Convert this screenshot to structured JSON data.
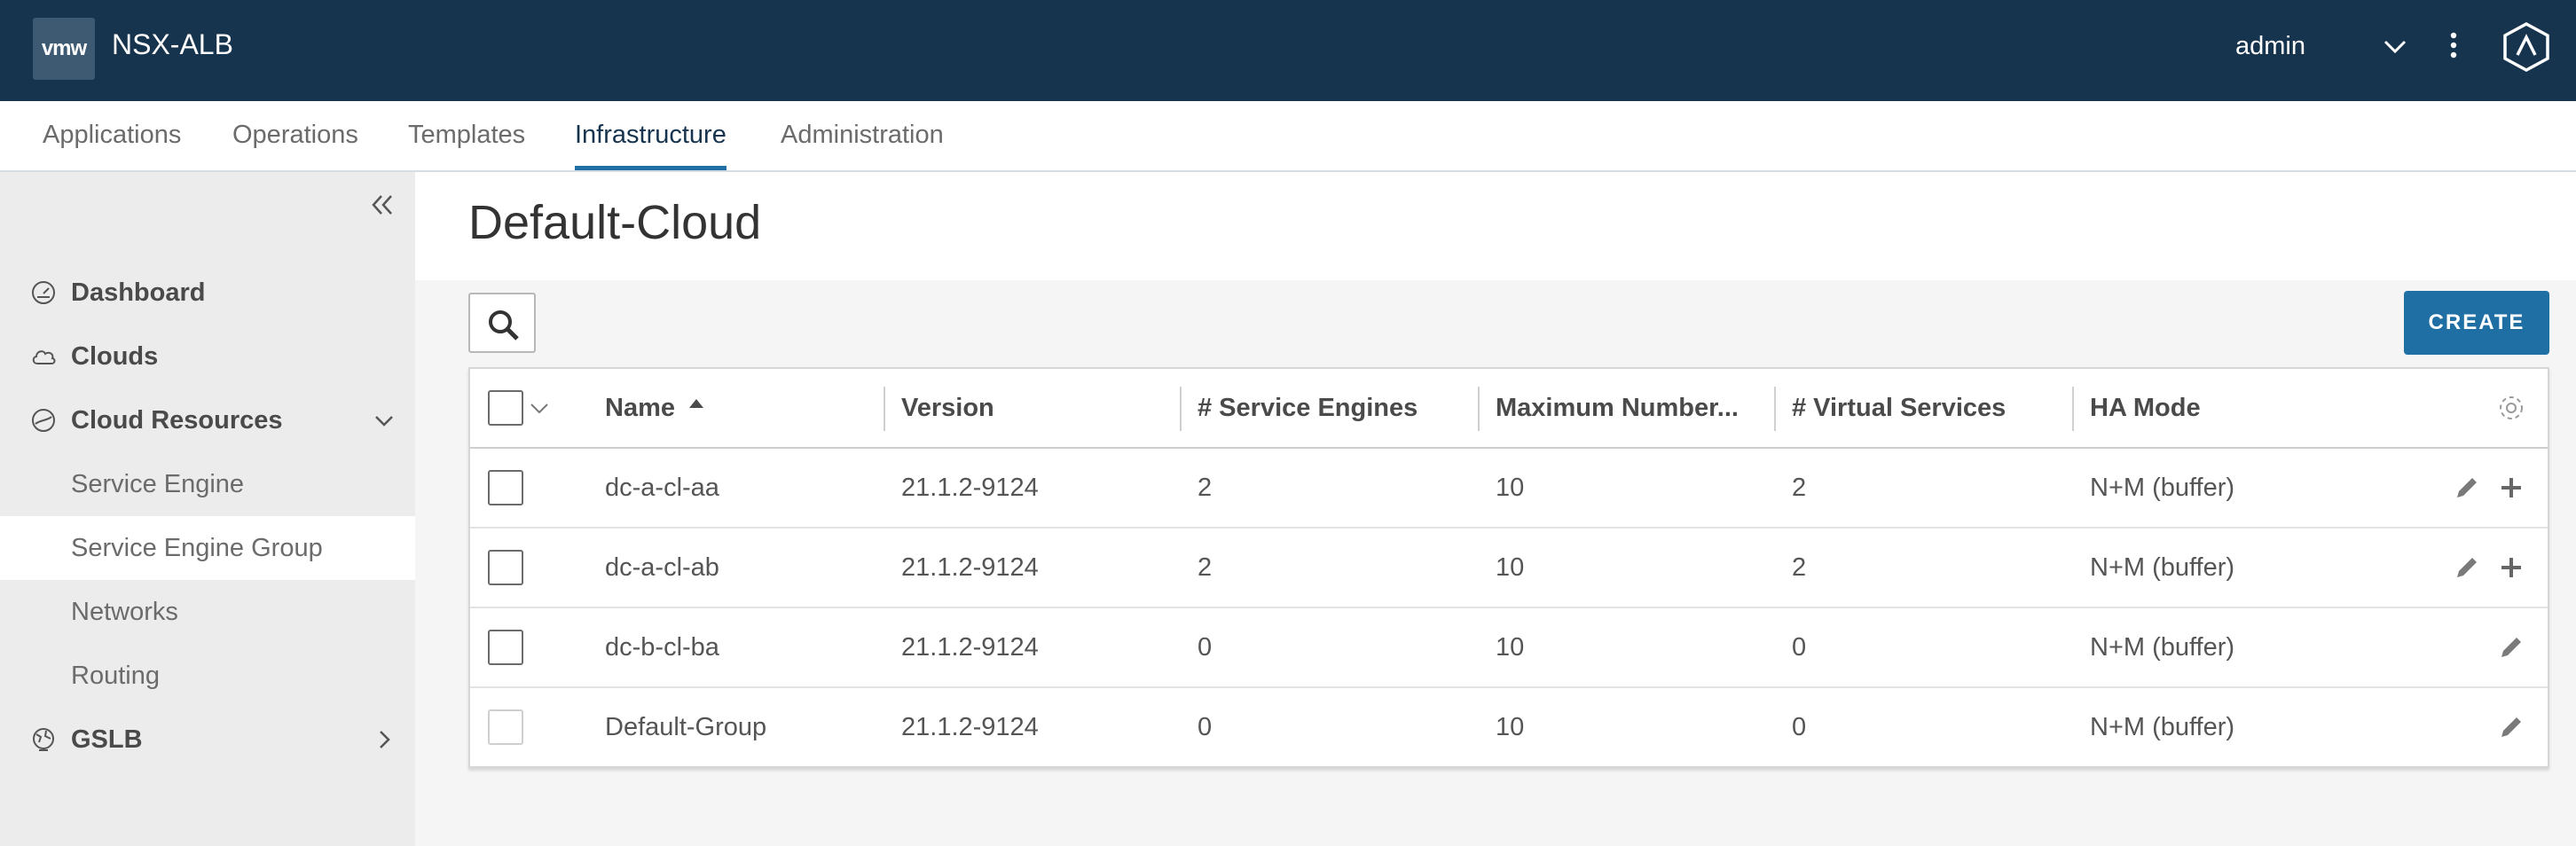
{
  "header": {
    "logo_text": "vmw",
    "app_title": "NSX-ALB",
    "user": "admin"
  },
  "topnav": {
    "tabs": [
      {
        "label": "Applications"
      },
      {
        "label": "Operations"
      },
      {
        "label": "Templates"
      },
      {
        "label": "Infrastructure",
        "active": true
      },
      {
        "label": "Administration"
      }
    ]
  },
  "sidebar": {
    "items": [
      {
        "label": "Dashboard",
        "icon": "gauge-icon"
      },
      {
        "label": "Clouds",
        "icon": "cloud-icon"
      },
      {
        "label": "Cloud Resources",
        "icon": "cloud-resources-icon",
        "expanded": true,
        "children": [
          {
            "label": "Service Engine"
          },
          {
            "label": "Service Engine Group",
            "active": true
          },
          {
            "label": "Networks"
          },
          {
            "label": "Routing"
          }
        ]
      },
      {
        "label": "GSLB",
        "icon": "globe-icon"
      }
    ]
  },
  "main": {
    "title": "Default-Cloud",
    "create_label": "CREATE"
  },
  "table": {
    "columns": [
      "Name",
      "Version",
      "# Service Engines",
      "Maximum Number...",
      "# Virtual Services",
      "HA Mode"
    ],
    "rows": [
      {
        "name": "dc-a-cl-aa",
        "version": "21.1.2-9124",
        "service_engines": "2",
        "max_number": "10",
        "virtual_services": "2",
        "ha_mode": "N+M (buffer)"
      },
      {
        "name": "dc-a-cl-ab",
        "version": "21.1.2-9124",
        "service_engines": "2",
        "max_number": "10",
        "virtual_services": "2",
        "ha_mode": "N+M (buffer)"
      },
      {
        "name": "dc-b-cl-ba",
        "version": "21.1.2-9124",
        "service_engines": "0",
        "max_number": "10",
        "virtual_services": "0",
        "ha_mode": "N+M (buffer)"
      },
      {
        "name": "Default-Group",
        "version": "21.1.2-9124",
        "service_engines": "0",
        "max_number": "10",
        "virtual_services": "0",
        "ha_mode": "N+M (buffer)"
      }
    ]
  },
  "colors": {
    "header_bg": "#17344e",
    "accent": "#1f6fa5",
    "sidebar_bg": "#ececec"
  }
}
